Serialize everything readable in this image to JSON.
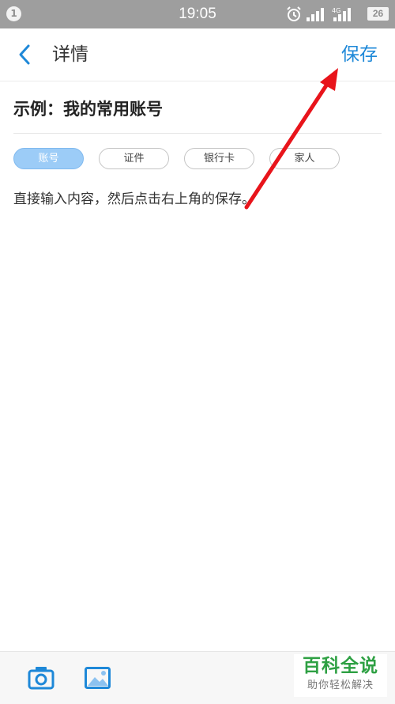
{
  "status_bar": {
    "notification_count": "1",
    "time": "19:05",
    "network": "4G",
    "battery": "26"
  },
  "header": {
    "title": "详情",
    "save_label": "保存"
  },
  "main": {
    "example_title": "示例：我的常用账号",
    "tags": [
      {
        "label": "账号",
        "selected": true
      },
      {
        "label": "证件",
        "selected": false
      },
      {
        "label": "银行卡",
        "selected": false
      },
      {
        "label": "家人",
        "selected": false
      }
    ],
    "content": "直接输入内容，然后点击右上角的保存。"
  },
  "colors": {
    "accent": "#1e88d8",
    "tag_selected": "#9cccf7",
    "annotation_arrow": "#e8141b",
    "watermark": "#2ea043"
  },
  "bottom_toolbar": {
    "icons": [
      "camera-icon",
      "image-icon"
    ]
  },
  "watermark": {
    "main": "百科全说",
    "sub": "助你轻松解决"
  }
}
